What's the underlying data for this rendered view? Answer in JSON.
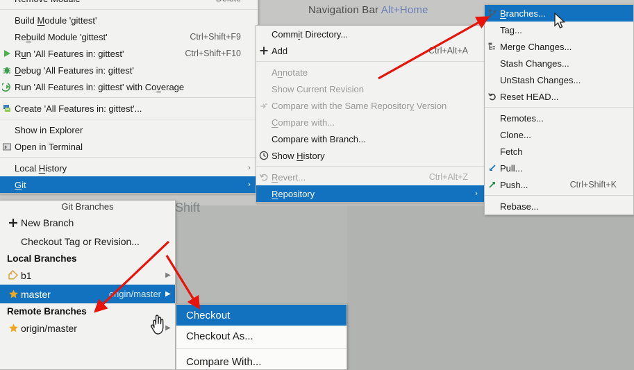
{
  "app": {
    "hint_navigation_bar": "Navigation Bar",
    "hint_navigation_bar_key": "Alt+Home",
    "hint_shift": "Shift",
    "hint_git_branches_bg": "Git Branches"
  },
  "colors": {
    "selection": "#1272c0",
    "menu_bg": "#f2f2f0",
    "backdrop": "#b0b3b0",
    "annotation_arrow": "#e8140a",
    "disabled_text": "#9a9a98"
  },
  "module_menu": {
    "items": [
      {
        "label": "Remove Module",
        "accel": "Delete",
        "icon": "",
        "state": "normal",
        "mnemonic": ""
      },
      {
        "separator": true
      },
      {
        "label": "Build Module 'gittest'",
        "accel": "",
        "icon": "",
        "state": "normal",
        "mnemonic": "M"
      },
      {
        "label": "Rebuild Module 'gittest'",
        "accel": "Ctrl+Shift+F9",
        "icon": "",
        "state": "normal",
        "mnemonic": "b"
      },
      {
        "label": "Run 'All Features in: gittest'",
        "accel": "Ctrl+Shift+F10",
        "icon": "run-icon",
        "state": "normal",
        "mnemonic": "u"
      },
      {
        "label": "Debug 'All Features in: gittest'",
        "accel": "",
        "icon": "debug-icon",
        "state": "normal",
        "mnemonic": "D"
      },
      {
        "label": "Run 'All Features in: gittest' with Coverage",
        "accel": "",
        "icon": "coverage-icon",
        "state": "normal",
        "mnemonic": "v"
      },
      {
        "separator": true
      },
      {
        "label": "Create 'All Features in: gittest'...",
        "accel": "",
        "icon": "create-config-icon",
        "state": "normal",
        "mnemonic": ""
      },
      {
        "separator": true
      },
      {
        "label": "Show in Explorer",
        "accel": "",
        "icon": "",
        "state": "normal",
        "mnemonic": ""
      },
      {
        "label": "Open in Terminal",
        "accel": "",
        "icon": "terminal-icon",
        "state": "normal",
        "mnemonic": ""
      },
      {
        "separator": true
      },
      {
        "label": "Local History",
        "accel": "",
        "icon": "",
        "state": "submenu",
        "mnemonic": "H"
      },
      {
        "label": "Git",
        "accel": "",
        "icon": "",
        "state": "submenu-selected",
        "mnemonic": "G"
      }
    ]
  },
  "git_menu": {
    "items": [
      {
        "label": "Commit Directory...",
        "accel": "",
        "icon": "",
        "state": "normal",
        "mnemonic": "i"
      },
      {
        "label": "Add",
        "accel": "Ctrl+Alt+A",
        "icon": "add-icon",
        "state": "normal",
        "mnemonic": ""
      },
      {
        "separator": true
      },
      {
        "label": "Annotate",
        "accel": "",
        "icon": "",
        "state": "disabled",
        "mnemonic": "n"
      },
      {
        "label": "Show Current Revision",
        "accel": "",
        "icon": "",
        "state": "disabled",
        "mnemonic": ""
      },
      {
        "label": "Compare with the Same Repository Version",
        "accel": "",
        "icon": "compare-same-icon",
        "state": "disabled",
        "mnemonic": "y"
      },
      {
        "label": "Compare with...",
        "accel": "",
        "icon": "",
        "state": "disabled",
        "mnemonic": "C"
      },
      {
        "label": "Compare with Branch...",
        "accel": "",
        "icon": "",
        "state": "normal",
        "mnemonic": ""
      },
      {
        "label": "Show History",
        "accel": "",
        "icon": "history-icon",
        "state": "normal",
        "mnemonic": "H"
      },
      {
        "separator": true
      },
      {
        "label": "Revert...",
        "accel": "Ctrl+Alt+Z",
        "icon": "revert-icon",
        "state": "disabled",
        "mnemonic": "R"
      },
      {
        "label": "Repository",
        "accel": "",
        "icon": "",
        "state": "submenu-selected",
        "mnemonic": "R"
      }
    ]
  },
  "repository_menu": {
    "items": [
      {
        "label": "Branches...",
        "accel": "",
        "icon": "branch-icon",
        "state": "selected",
        "mnemonic": "B"
      },
      {
        "label": "Tag...",
        "accel": "",
        "icon": "",
        "state": "normal",
        "mnemonic": ""
      },
      {
        "label": "Merge Changes...",
        "accel": "",
        "icon": "merge-icon",
        "state": "normal",
        "mnemonic": ""
      },
      {
        "label": "Stash Changes...",
        "accel": "",
        "icon": "",
        "state": "normal",
        "mnemonic": ""
      },
      {
        "label": "UnStash Changes...",
        "accel": "",
        "icon": "",
        "state": "normal",
        "mnemonic": ""
      },
      {
        "label": "Reset HEAD...",
        "accel": "",
        "icon": "reset-icon",
        "state": "normal",
        "mnemonic": ""
      },
      {
        "separator": true
      },
      {
        "label": "Remotes...",
        "accel": "",
        "icon": "",
        "state": "normal",
        "mnemonic": ""
      },
      {
        "label": "Clone...",
        "accel": "",
        "icon": "",
        "state": "normal",
        "mnemonic": ""
      },
      {
        "label": "Fetch",
        "accel": "",
        "icon": "",
        "state": "normal",
        "mnemonic": ""
      },
      {
        "label": "Pull...",
        "accel": "",
        "icon": "pull-icon",
        "state": "normal",
        "mnemonic": ""
      },
      {
        "label": "Push...",
        "accel": "Ctrl+Shift+K",
        "icon": "push-icon",
        "state": "normal",
        "mnemonic": ""
      },
      {
        "separator": true
      },
      {
        "label": "Rebase...",
        "accel": "",
        "icon": "",
        "state": "normal",
        "mnemonic": ""
      }
    ]
  },
  "branches_popup": {
    "title": "Git Branches",
    "actions": [
      {
        "label": "New Branch",
        "icon": "plus-icon"
      },
      {
        "label": "Checkout Tag or Revision...",
        "icon": ""
      }
    ],
    "local_header": "Local Branches",
    "local": [
      {
        "name": "b1",
        "remote": "",
        "icon": "tag-icon",
        "selected": false
      },
      {
        "name": "master",
        "remote": "origin/master",
        "icon": "star-icon",
        "selected": true
      }
    ],
    "remote_header": "Remote Branches",
    "remote": [
      {
        "name": "origin/master",
        "remote": "",
        "icon": "star-icon",
        "selected": false
      }
    ]
  },
  "checkout_menu": {
    "items": [
      {
        "label": "Checkout",
        "selected": true
      },
      {
        "label": "Checkout As...",
        "selected": false
      },
      {
        "separator": true
      },
      {
        "label": "Compare With...",
        "selected": false
      }
    ]
  }
}
